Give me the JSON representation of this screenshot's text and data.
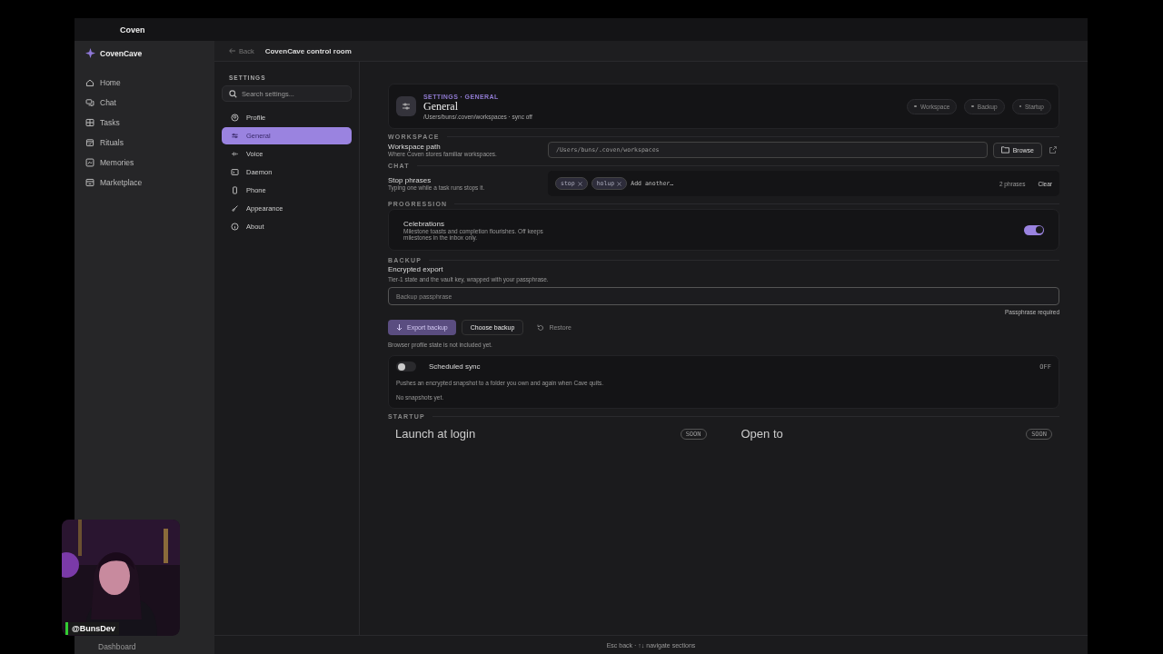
{
  "app": {
    "title": "Coven",
    "brand": "CovenCave"
  },
  "nav": [
    {
      "label": "Home"
    },
    {
      "label": "Chat"
    },
    {
      "label": "Tasks"
    },
    {
      "label": "Rituals"
    },
    {
      "label": "Memories"
    },
    {
      "label": "Marketplace"
    }
  ],
  "nav_footer": {
    "label": "Dashboard"
  },
  "header": {
    "back": "Back",
    "title": "CovenCave control room"
  },
  "settings": {
    "heading": "SETTINGS",
    "search_placeholder": "Search settings...",
    "items": [
      {
        "label": "Profile",
        "selected": false
      },
      {
        "label": "General",
        "selected": true
      },
      {
        "label": "Voice",
        "selected": false
      },
      {
        "label": "Daemon",
        "selected": false
      },
      {
        "label": "Phone",
        "selected": false
      },
      {
        "label": "Appearance",
        "selected": false
      },
      {
        "label": "About",
        "selected": false
      }
    ]
  },
  "page": {
    "breadcrumb": "SETTINGS · GENERAL",
    "title": "General",
    "subtitle": "/Users/buns/.coven/workspaces · sync off",
    "chips": [
      "Workspace",
      "Backup",
      "Startup"
    ]
  },
  "workspace": {
    "heading": "WORKSPACE",
    "label": "Workspace path",
    "hint": "Where Coven stores familiar workspaces.",
    "value": "/Users/buns/.coven/workspaces",
    "browse": "Browse"
  },
  "chat": {
    "heading": "CHAT",
    "label": "Stop phrases",
    "hint": "Typing one while a task runs stops it.",
    "tags": [
      "stop",
      "holup"
    ],
    "placeholder": "Add another…",
    "count": "2 phrases",
    "clear": "Clear"
  },
  "progression": {
    "heading": "PROGRESSION",
    "label": "Celebrations",
    "hint": "Milestone toasts and completion flourishes. Off keeps milestones in the inbox only.",
    "on": true
  },
  "backup": {
    "heading": "BACKUP",
    "label": "Encrypted export",
    "hint": "Tier-1 state and the vault key, wrapped with your passphrase.",
    "placeholder": "Backup passphrase",
    "error": "Passphrase required",
    "buttons": [
      {
        "label": "Export backup",
        "kind": "primary",
        "disabled": true
      },
      {
        "label": "Choose backup",
        "kind": "secondary",
        "disabled": false
      },
      {
        "label": "Restore",
        "kind": "ghost",
        "disabled": true
      }
    ],
    "note": "Browser profile state is not included yet.",
    "sync": {
      "label": "Scheduled sync",
      "on": false,
      "status": "OFF",
      "hint": "Pushes an encrypted snapshot to a folder you own and again when Cave quits.",
      "empty": "No snapshots yet."
    }
  },
  "startup": {
    "heading": "STARTUP",
    "items": [
      {
        "label": "Launch at login",
        "badge": "SOON"
      },
      {
        "label": "Open to",
        "badge": "SOON"
      }
    ]
  },
  "footer": {
    "hint": "Esc back · ↑↓ navigate sections"
  },
  "webcam": {
    "kind": "picture",
    "handle": "@BunsDev"
  }
}
